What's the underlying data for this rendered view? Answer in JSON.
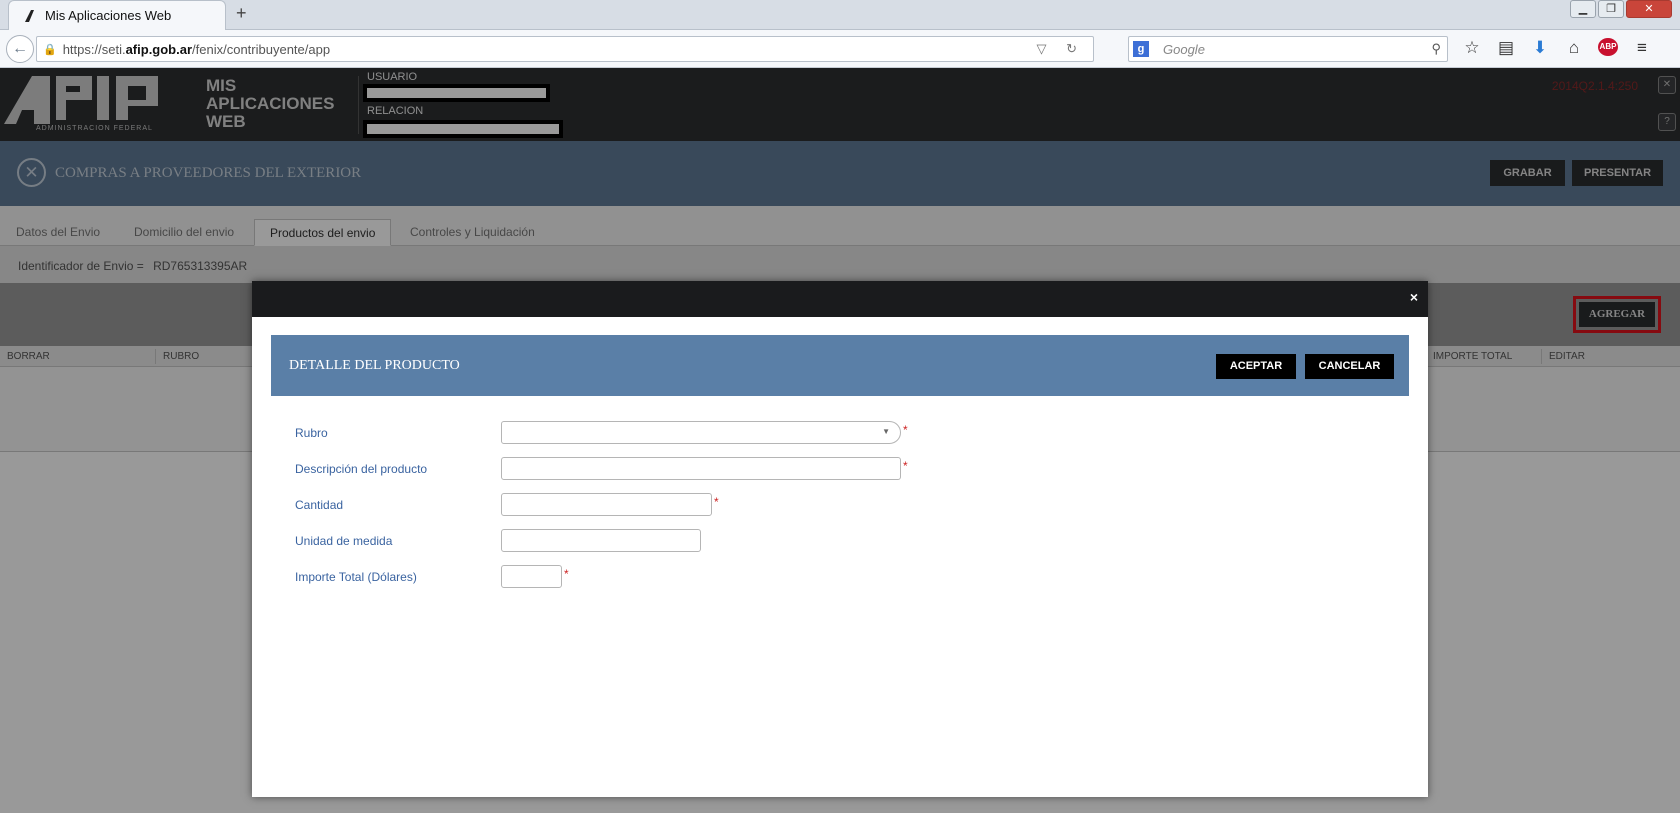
{
  "browser": {
    "tab_title": "Mis Aplicaciones Web",
    "new_tab": "+",
    "url_prefix": "https://seti.",
    "url_domain": "afip.gob.ar",
    "url_path": "/fenix/contribuyente/app",
    "search_placeholder": "Google"
  },
  "header": {
    "logo_text": "ADMINISTRACION FEDERAL",
    "app_title_line1": "MIS",
    "app_title_line2": "APLICACIONES",
    "app_title_line3": "WEB",
    "usuario_label": "USUARIO",
    "relacion_label": "RELACION",
    "version": "2014Q2.1.4:250",
    "close_icon_label": "✕",
    "help_icon_label": "?"
  },
  "page": {
    "title": "COMPRAS A PROVEEDORES DEL EXTERIOR",
    "grabar_label": "GRABAR",
    "presentar_label": "PRESENTAR",
    "tabs": [
      {
        "label": "Datos del Envio"
      },
      {
        "label": "Domicilio del envio"
      },
      {
        "label": "Productos del envio"
      },
      {
        "label": "Controles y Liquidación"
      }
    ],
    "active_tab": "Productos del envio",
    "identificador_label": "Identificador de Envio = ",
    "identificador_value": "RD765313395AR",
    "agregar_label": "AGREGAR",
    "table_headers": {
      "borrar": "BORRAR",
      "rubro": "RUBRO",
      "importe_total": "IMPORTE TOTAL",
      "editar": "EDITAR"
    }
  },
  "modal": {
    "close_label": "×",
    "section_title": "DETALLE DEL PRODUCTO",
    "aceptar_label": "ACEPTAR",
    "cancelar_label": "CANCELAR",
    "fields": {
      "rubro": {
        "label": "Rubro",
        "value": "",
        "required": true
      },
      "descripcion": {
        "label": "Descripción del producto",
        "value": "",
        "required": true
      },
      "cantidad": {
        "label": "Cantidad",
        "value": "",
        "required": true
      },
      "unidad": {
        "label": "Unidad de medida",
        "value": "",
        "required": false
      },
      "importe": {
        "label": "Importe Total (Dólares)",
        "value": "",
        "required": true
      }
    },
    "required_mark": "*"
  },
  "colors": {
    "title_bar": "#5f7a97",
    "detail_bar": "#5a7fa7",
    "header_dark": "#2d2f31",
    "highlight_red": "#e0121c",
    "label_blue": "#3a63a0"
  }
}
